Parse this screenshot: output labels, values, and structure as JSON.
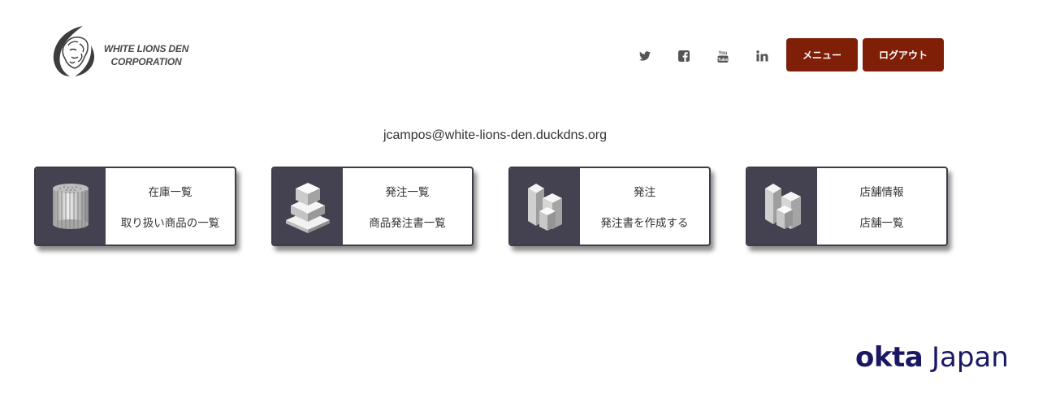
{
  "brand": {
    "logo_line1": "WHITE LIONS DEN",
    "logo_line2": "CORPORATION"
  },
  "header": {
    "social_icons": [
      "twitter-icon",
      "facebook-icon",
      "youtube-icon",
      "linkedin-icon"
    ],
    "menu_label": "メニュー",
    "logout_label": "ログアウト",
    "button_color": "#7f1f08"
  },
  "user": {
    "email": "jcampos@white-lions-den.duckdns.org"
  },
  "cards": [
    {
      "title": "在庫一覧",
      "subtitle": "取り扱い商品の一覧",
      "icon": "inventory-cylinder-icon"
    },
    {
      "title": "発注一覧",
      "subtitle": "商品発注書一覧",
      "icon": "order-list-stack-icon"
    },
    {
      "title": "発注",
      "subtitle": "発注書を作成する",
      "icon": "create-order-blocks-icon"
    },
    {
      "title": "店舗情報",
      "subtitle": "店舗一覧",
      "icon": "store-blocks-icon"
    }
  ],
  "footer": {
    "okta_word": "okta",
    "okta_suffix": "Japan",
    "okta_color": "#1a1765"
  }
}
